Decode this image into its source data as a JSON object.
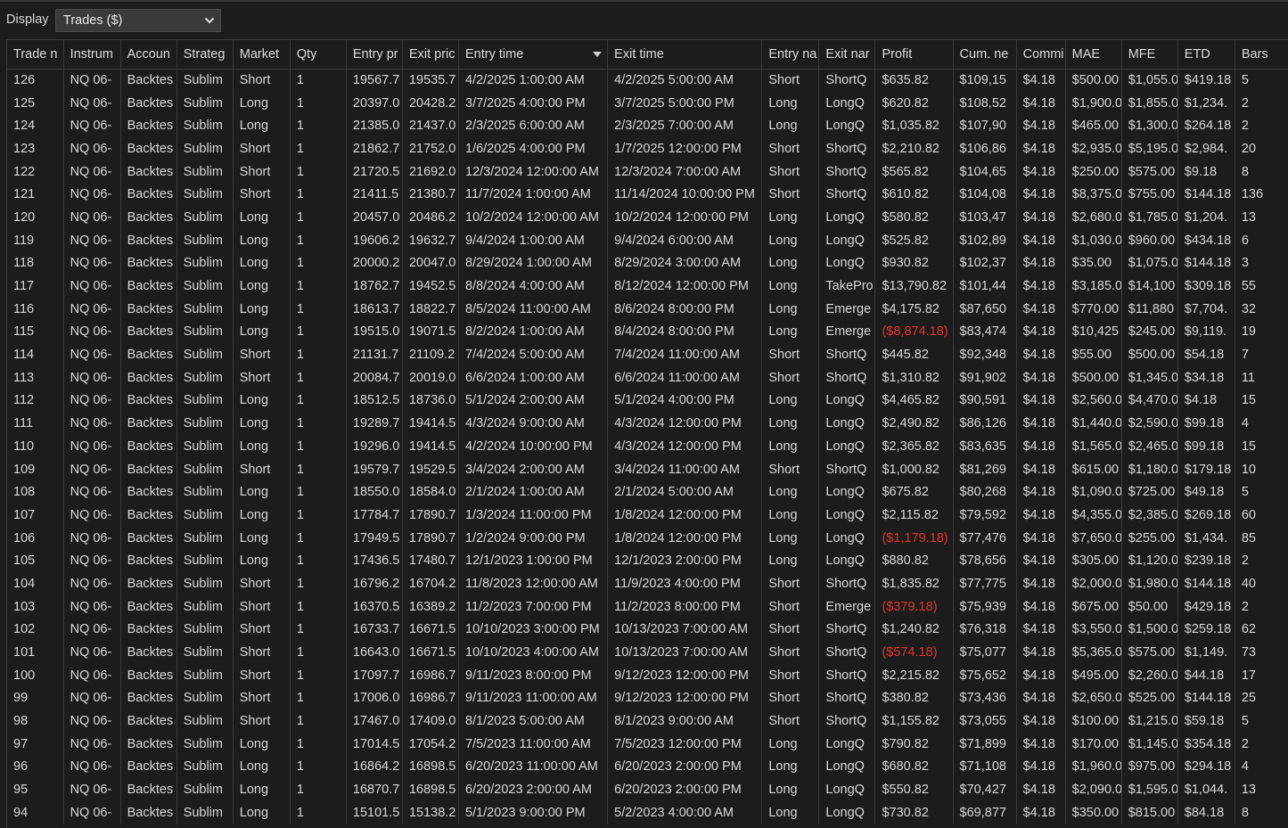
{
  "display": {
    "label": "Display",
    "selected": "Trades ($)"
  },
  "colors": {
    "background": "#1c1c1c",
    "text": "#d8d8d8",
    "negative": "#e0352b"
  },
  "table": {
    "columns": [
      "Trade n",
      "Instrum",
      "Accoun",
      "Strateg",
      "Market",
      "Qty",
      "Entry pr",
      "Exit pric",
      "Entry time",
      "Exit time",
      "Entry na",
      "Exit nar",
      "Profit",
      "Cum. ne",
      "Commi",
      "MAE",
      "MFE",
      "ETD",
      "Bars"
    ],
    "sorted_column": "Entry time",
    "rows": [
      [
        "126",
        "NQ 06-",
        "Backtes",
        "Sublim",
        "Short",
        "1",
        "19567.7",
        "19535.7",
        "4/2/2025 1:00:00 AM",
        "4/2/2025 5:00:00 AM",
        "Short",
        "ShortQ",
        "$635.82",
        "$109,15",
        "$4.18",
        "$500.00",
        "$1,055.0",
        "$419.18",
        "5"
      ],
      [
        "125",
        "NQ 06-",
        "Backtes",
        "Sublim",
        "Long",
        "1",
        "20397.0",
        "20428.2",
        "3/7/2025 4:00:00 PM",
        "3/7/2025 5:00:00 PM",
        "Long",
        "LongQ",
        "$620.82",
        "$108,52",
        "$4.18",
        "$1,900.0",
        "$1,855.0",
        "$1,234.",
        "2"
      ],
      [
        "124",
        "NQ 06-",
        "Backtes",
        "Sublim",
        "Long",
        "1",
        "21385.0",
        "21437.0",
        "2/3/2025 6:00:00 AM",
        "2/3/2025 7:00:00 AM",
        "Long",
        "LongQ",
        "$1,035.82",
        "$107,90",
        "$4.18",
        "$465.00",
        "$1,300.0",
        "$264.18",
        "2"
      ],
      [
        "123",
        "NQ 06-",
        "Backtes",
        "Sublim",
        "Short",
        "1",
        "21862.7",
        "21752.0",
        "1/6/2025 4:00:00 PM",
        "1/7/2025 12:00:00 PM",
        "Short",
        "ShortQ",
        "$2,210.82",
        "$106,86",
        "$4.18",
        "$2,935.0",
        "$5,195.0",
        "$2,984.",
        "20"
      ],
      [
        "122",
        "NQ 06-",
        "Backtes",
        "Sublim",
        "Short",
        "1",
        "21720.5",
        "21692.0",
        "12/3/2024 12:00:00 AM",
        "12/3/2024 7:00:00 AM",
        "Short",
        "ShortQ",
        "$565.82",
        "$104,65",
        "$4.18",
        "$250.00",
        "$575.00",
        "$9.18",
        "8"
      ],
      [
        "121",
        "NQ 06-",
        "Backtes",
        "Sublim",
        "Short",
        "1",
        "21411.5",
        "21380.7",
        "11/7/2024 1:00:00 AM",
        "11/14/2024 10:00:00 PM",
        "Short",
        "ShortQ",
        "$610.82",
        "$104,08",
        "$4.18",
        "$8,375.0",
        "$755.00",
        "$144.18",
        "136"
      ],
      [
        "120",
        "NQ 06-",
        "Backtes",
        "Sublim",
        "Long",
        "1",
        "20457.0",
        "20486.2",
        "10/2/2024 12:00:00 AM",
        "10/2/2024 12:00:00 PM",
        "Long",
        "LongQ",
        "$580.82",
        "$103,47",
        "$4.18",
        "$2,680.0",
        "$1,785.0",
        "$1,204.",
        "13"
      ],
      [
        "119",
        "NQ 06-",
        "Backtes",
        "Sublim",
        "Long",
        "1",
        "19606.2",
        "19632.7",
        "9/4/2024 1:00:00 AM",
        "9/4/2024 6:00:00 AM",
        "Long",
        "LongQ",
        "$525.82",
        "$102,89",
        "$4.18",
        "$1,030.0",
        "$960.00",
        "$434.18",
        "6"
      ],
      [
        "118",
        "NQ 06-",
        "Backtes",
        "Sublim",
        "Long",
        "1",
        "20000.2",
        "20047.0",
        "8/29/2024 1:00:00 AM",
        "8/29/2024 3:00:00 AM",
        "Long",
        "LongQ",
        "$930.82",
        "$102,37",
        "$4.18",
        "$35.00",
        "$1,075.0",
        "$144.18",
        "3"
      ],
      [
        "117",
        "NQ 06-",
        "Backtes",
        "Sublim",
        "Long",
        "1",
        "18762.7",
        "19452.5",
        "8/8/2024 4:00:00 AM",
        "8/12/2024 12:00:00 PM",
        "Long",
        "TakePro",
        "$13,790.82",
        "$101,44",
        "$4.18",
        "$3,185.0",
        "$14,100",
        "$309.18",
        "55"
      ],
      [
        "116",
        "NQ 06-",
        "Backtes",
        "Sublim",
        "Long",
        "1",
        "18613.7",
        "18822.7",
        "8/5/2024 11:00:00 AM",
        "8/6/2024 8:00:00 PM",
        "Long",
        "Emerge",
        "$4,175.82",
        "$87,650",
        "$4.18",
        "$770.00",
        "$11,880",
        "$7,704.",
        "32"
      ],
      [
        "115",
        "NQ 06-",
        "Backtes",
        "Sublim",
        "Long",
        "1",
        "19515.0",
        "19071.5",
        "8/2/2024 1:00:00 AM",
        "8/4/2024 8:00:00 PM",
        "Long",
        "Emerge",
        "($8,874.18)",
        "$83,474",
        "$4.18",
        "$10,425",
        "$245.00",
        "$9,119.",
        "19"
      ],
      [
        "114",
        "NQ 06-",
        "Backtes",
        "Sublim",
        "Short",
        "1",
        "21131.7",
        "21109.2",
        "7/4/2024 5:00:00 AM",
        "7/4/2024 11:00:00 AM",
        "Short",
        "ShortQ",
        "$445.82",
        "$92,348",
        "$4.18",
        "$55.00",
        "$500.00",
        "$54.18",
        "7"
      ],
      [
        "113",
        "NQ 06-",
        "Backtes",
        "Sublim",
        "Short",
        "1",
        "20084.7",
        "20019.0",
        "6/6/2024 1:00:00 AM",
        "6/6/2024 11:00:00 AM",
        "Short",
        "ShortQ",
        "$1,310.82",
        "$91,902",
        "$4.18",
        "$500.00",
        "$1,345.0",
        "$34.18",
        "11"
      ],
      [
        "112",
        "NQ 06-",
        "Backtes",
        "Sublim",
        "Long",
        "1",
        "18512.5",
        "18736.0",
        "5/1/2024 2:00:00 AM",
        "5/1/2024 4:00:00 PM",
        "Long",
        "LongQ",
        "$4,465.82",
        "$90,591",
        "$4.18",
        "$2,560.0",
        "$4,470.0",
        "$4.18",
        "15"
      ],
      [
        "111",
        "NQ 06-",
        "Backtes",
        "Sublim",
        "Long",
        "1",
        "19289.7",
        "19414.5",
        "4/3/2024 9:00:00 AM",
        "4/3/2024 12:00:00 PM",
        "Long",
        "LongQ",
        "$2,490.82",
        "$86,126",
        "$4.18",
        "$1,440.0",
        "$2,590.0",
        "$99.18",
        "4"
      ],
      [
        "110",
        "NQ 06-",
        "Backtes",
        "Sublim",
        "Long",
        "1",
        "19296.0",
        "19414.5",
        "4/2/2024 10:00:00 PM",
        "4/3/2024 12:00:00 PM",
        "Long",
        "LongQ",
        "$2,365.82",
        "$83,635",
        "$4.18",
        "$1,565.0",
        "$2,465.0",
        "$99.18",
        "15"
      ],
      [
        "109",
        "NQ 06-",
        "Backtes",
        "Sublim",
        "Short",
        "1",
        "19579.7",
        "19529.5",
        "3/4/2024 2:00:00 AM",
        "3/4/2024 11:00:00 AM",
        "Short",
        "ShortQ",
        "$1,000.82",
        "$81,269",
        "$4.18",
        "$615.00",
        "$1,180.0",
        "$179.18",
        "10"
      ],
      [
        "108",
        "NQ 06-",
        "Backtes",
        "Sublim",
        "Long",
        "1",
        "18550.0",
        "18584.0",
        "2/1/2024 1:00:00 AM",
        "2/1/2024 5:00:00 AM",
        "Long",
        "LongQ",
        "$675.82",
        "$80,268",
        "$4.18",
        "$1,090.0",
        "$725.00",
        "$49.18",
        "5"
      ],
      [
        "107",
        "NQ 06-",
        "Backtes",
        "Sublim",
        "Long",
        "1",
        "17784.7",
        "17890.7",
        "1/3/2024 11:00:00 PM",
        "1/8/2024 12:00:00 PM",
        "Long",
        "LongQ",
        "$2,115.82",
        "$79,592",
        "$4.18",
        "$4,355.0",
        "$2,385.0",
        "$269.18",
        "60"
      ],
      [
        "106",
        "NQ 06-",
        "Backtes",
        "Sublim",
        "Long",
        "1",
        "17949.5",
        "17890.7",
        "1/2/2024 9:00:00 PM",
        "1/8/2024 12:00:00 PM",
        "Long",
        "LongQ",
        "($1,179.18)",
        "$77,476",
        "$4.18",
        "$7,650.0",
        "$255.00",
        "$1,434.",
        "85"
      ],
      [
        "105",
        "NQ 06-",
        "Backtes",
        "Sublim",
        "Long",
        "1",
        "17436.5",
        "17480.7",
        "12/1/2023 1:00:00 PM",
        "12/1/2023 2:00:00 PM",
        "Long",
        "LongQ",
        "$880.82",
        "$78,656",
        "$4.18",
        "$305.00",
        "$1,120.0",
        "$239.18",
        "2"
      ],
      [
        "104",
        "NQ 06-",
        "Backtes",
        "Sublim",
        "Short",
        "1",
        "16796.2",
        "16704.2",
        "11/8/2023 12:00:00 AM",
        "11/9/2023 4:00:00 PM",
        "Short",
        "ShortQ",
        "$1,835.82",
        "$77,775",
        "$4.18",
        "$2,000.0",
        "$1,980.0",
        "$144.18",
        "40"
      ],
      [
        "103",
        "NQ 06-",
        "Backtes",
        "Sublim",
        "Short",
        "1",
        "16370.5",
        "16389.2",
        "11/2/2023 7:00:00 PM",
        "11/2/2023 8:00:00 PM",
        "Short",
        "Emerge",
        "($379.18)",
        "$75,939",
        "$4.18",
        "$675.00",
        "$50.00",
        "$429.18",
        "2"
      ],
      [
        "102",
        "NQ 06-",
        "Backtes",
        "Sublim",
        "Short",
        "1",
        "16733.7",
        "16671.5",
        "10/10/2023 3:00:00 PM",
        "10/13/2023 7:00:00 AM",
        "Short",
        "ShortQ",
        "$1,240.82",
        "$76,318",
        "$4.18",
        "$3,550.0",
        "$1,500.0",
        "$259.18",
        "62"
      ],
      [
        "101",
        "NQ 06-",
        "Backtes",
        "Sublim",
        "Short",
        "1",
        "16643.0",
        "16671.5",
        "10/10/2023 4:00:00 AM",
        "10/13/2023 7:00:00 AM",
        "Short",
        "ShortQ",
        "($574.18)",
        "$75,077",
        "$4.18",
        "$5,365.0",
        "$575.00",
        "$1,149.",
        "73"
      ],
      [
        "100",
        "NQ 06-",
        "Backtes",
        "Sublim",
        "Short",
        "1",
        "17097.7",
        "16986.7",
        "9/11/2023 8:00:00 PM",
        "9/12/2023 12:00:00 PM",
        "Short",
        "ShortQ",
        "$2,215.82",
        "$75,652",
        "$4.18",
        "$495.00",
        "$2,260.0",
        "$44.18",
        "17"
      ],
      [
        "99",
        "NQ 06-",
        "Backtes",
        "Sublim",
        "Short",
        "1",
        "17006.0",
        "16986.7",
        "9/11/2023 11:00:00 AM",
        "9/12/2023 12:00:00 PM",
        "Short",
        "ShortQ",
        "$380.82",
        "$73,436",
        "$4.18",
        "$2,650.0",
        "$525.00",
        "$144.18",
        "25"
      ],
      [
        "98",
        "NQ 06-",
        "Backtes",
        "Sublim",
        "Short",
        "1",
        "17467.0",
        "17409.0",
        "8/1/2023 5:00:00 AM",
        "8/1/2023 9:00:00 AM",
        "Short",
        "ShortQ",
        "$1,155.82",
        "$73,055",
        "$4.18",
        "$100.00",
        "$1,215.0",
        "$59.18",
        "5"
      ],
      [
        "97",
        "NQ 06-",
        "Backtes",
        "Sublim",
        "Long",
        "1",
        "17014.5",
        "17054.2",
        "7/5/2023 11:00:00 AM",
        "7/5/2023 12:00:00 PM",
        "Long",
        "LongQ",
        "$790.82",
        "$71,899",
        "$4.18",
        "$170.00",
        "$1,145.0",
        "$354.18",
        "2"
      ],
      [
        "96",
        "NQ 06-",
        "Backtes",
        "Sublim",
        "Long",
        "1",
        "16864.2",
        "16898.5",
        "6/20/2023 11:00:00 AM",
        "6/20/2023 2:00:00 PM",
        "Long",
        "LongQ",
        "$680.82",
        "$71,108",
        "$4.18",
        "$1,960.0",
        "$975.00",
        "$294.18",
        "4"
      ],
      [
        "95",
        "NQ 06-",
        "Backtes",
        "Sublim",
        "Long",
        "1",
        "16870.7",
        "16898.5",
        "6/20/2023 2:00:00 AM",
        "6/20/2023 2:00:00 PM",
        "Long",
        "LongQ",
        "$550.82",
        "$70,427",
        "$4.18",
        "$2,090.0",
        "$1,595.0",
        "$1,044.",
        "13"
      ],
      [
        "94",
        "NQ 06-",
        "Backtes",
        "Sublim",
        "Long",
        "1",
        "15101.5",
        "15138.2",
        "5/1/2023 9:00:00 PM",
        "5/2/2023 4:00:00 AM",
        "Long",
        "LongQ",
        "$730.82",
        "$69,877",
        "$4.18",
        "$350.00",
        "$815.00",
        "$84.18",
        "8"
      ]
    ]
  }
}
